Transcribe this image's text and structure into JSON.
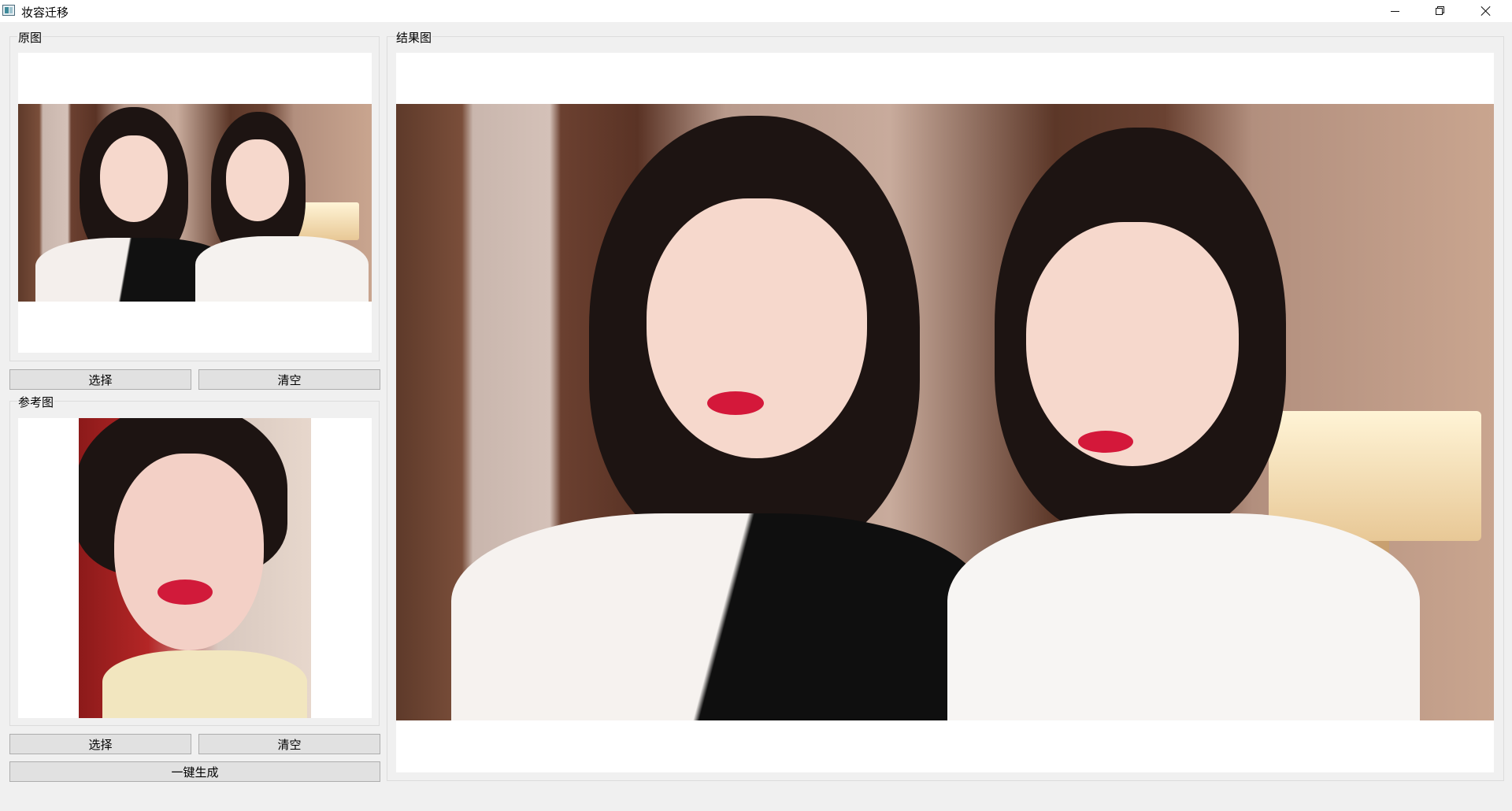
{
  "window": {
    "title": "妆容迁移",
    "controls": {
      "minimize_icon": "minimize-icon",
      "maximize_icon": "restore-icon",
      "close_icon": "close-icon"
    }
  },
  "left_panel": {
    "original": {
      "title": "原图",
      "image_description_icon": "photo-two-girls",
      "select_label": "选择",
      "clear_label": "清空"
    },
    "reference": {
      "title": "参考图",
      "image_description_icon": "photo-reference-makeup",
      "select_label": "选择",
      "clear_label": "清空"
    },
    "generate_label": "一键生成"
  },
  "result_panel": {
    "title": "结果图",
    "image_description_icon": "photo-result-two-girls"
  },
  "colors": {
    "window_bg": "#f0f0f0",
    "image_bg": "#ffffff",
    "button_bg": "#e1e1e1",
    "button_border": "#adadad"
  }
}
